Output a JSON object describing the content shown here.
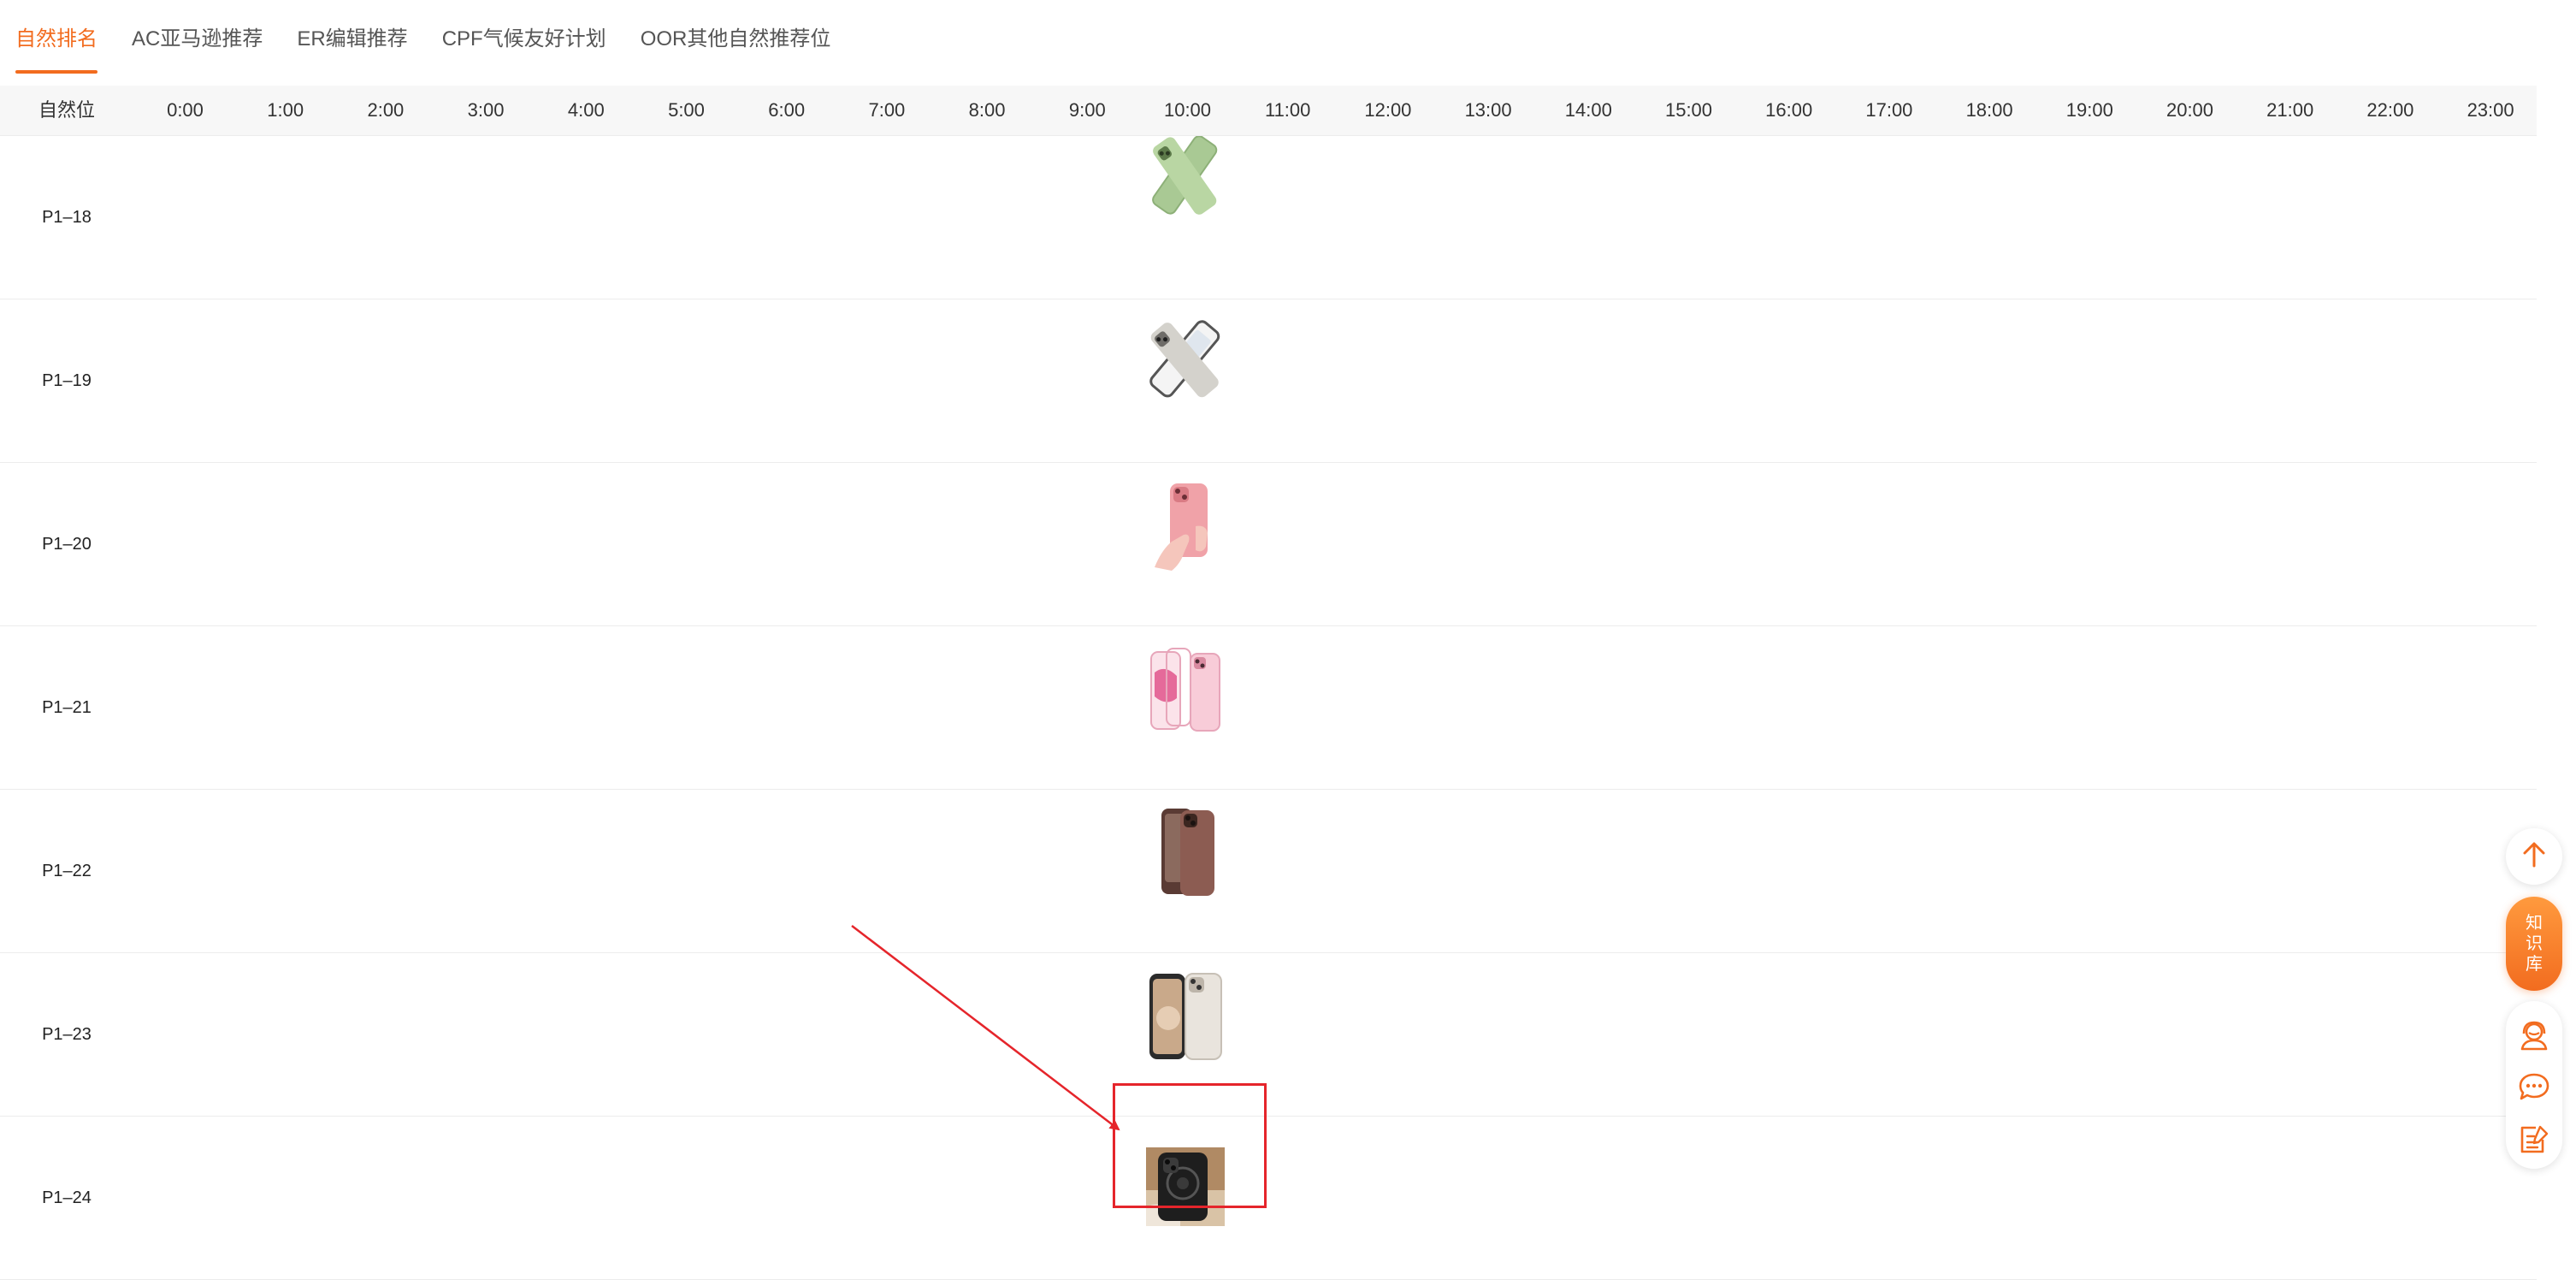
{
  "tabs": [
    {
      "label": "自然排名",
      "active": true
    },
    {
      "label": "AC亚马逊推荐",
      "active": false
    },
    {
      "label": "ER编辑推荐",
      "active": false
    },
    {
      "label": "CPF气候友好计划",
      "active": false
    },
    {
      "label": "OOR其他自然推荐位",
      "active": false
    }
  ],
  "table": {
    "position_header": "自然位",
    "hours": [
      "0:00",
      "1:00",
      "2:00",
      "3:00",
      "4:00",
      "5:00",
      "6:00",
      "7:00",
      "8:00",
      "9:00",
      "10:00",
      "11:00",
      "12:00",
      "13:00",
      "14:00",
      "15:00",
      "16:00",
      "17:00",
      "18:00",
      "19:00",
      "20:00",
      "21:00",
      "22:00",
      "23:00"
    ],
    "rows": [
      {
        "label": "P1–18",
        "image_hour": "10:00",
        "image": "green-phone-case-thumbnail"
      },
      {
        "label": "P1–19",
        "image_hour": "10:00",
        "image": "gray-phone-case-thumbnail"
      },
      {
        "label": "P1–20",
        "image_hour": "10:00",
        "image": "pink-phone-case-in-hand-thumbnail"
      },
      {
        "label": "P1–21",
        "image_hour": "10:00",
        "image": "clear-pink-phone-case-thumbnail"
      },
      {
        "label": "P1–22",
        "image_hour": "10:00",
        "image": "brown-phone-case-thumbnail"
      },
      {
        "label": "P1–23",
        "image_hour": "10:00",
        "image": "beige-phone-case-thumbnail"
      },
      {
        "label": "P1–24",
        "image_hour": "10:00",
        "image": "black-magsafe-phone-case-thumbnail",
        "highlighted": true
      }
    ]
  },
  "accent_color": "#f26c1f",
  "annotation_color": "#e5252b",
  "float_bar": {
    "knowledge_chars": [
      "知",
      "识",
      "库"
    ],
    "icons": [
      "arrow-up-icon",
      "customer-service-icon",
      "chat-icon",
      "feedback-icon"
    ]
  }
}
